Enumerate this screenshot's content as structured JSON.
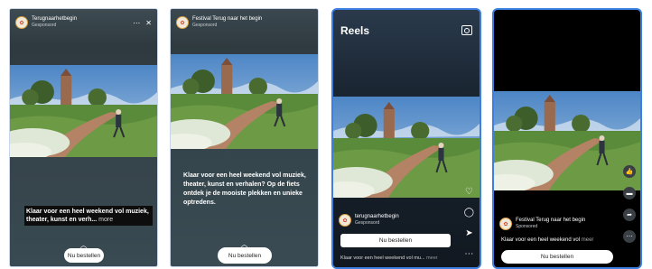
{
  "panel1": {
    "account": "Terugnaarhetbegin",
    "sponsored": "Gesponsord",
    "menu_icon": "more-icon",
    "close_icon": "close-icon",
    "caption": "Klaar voor een heel weekend vol muziek, theater, kunst en verh...",
    "more_label": "more",
    "cta": "Nu bestellen"
  },
  "panel2": {
    "account": "Festival Terug naar het begin",
    "sponsored": "Gesponsord",
    "caption": "Klaar voor een heel weekend vol muziek, theater, kunst en verhalen? Op de fiets ontdek je de mooiste plekken en unieke optredens.",
    "cta": "Nu bestellen"
  },
  "panel3": {
    "title": "Reels",
    "account": "terugnaarhetbegin",
    "sponsored": "Gesponsord",
    "cta": "Nu bestellen",
    "caption": "Klaar voor een heel weekend vol mu...",
    "more_label": "meer"
  },
  "panel4": {
    "account": "Festival Terug naar het begin",
    "sponsored": "Sponsored",
    "caption": "Klaar voor een heel weekend vol",
    "more_label": "meer",
    "cta": "Nu bestellen"
  }
}
